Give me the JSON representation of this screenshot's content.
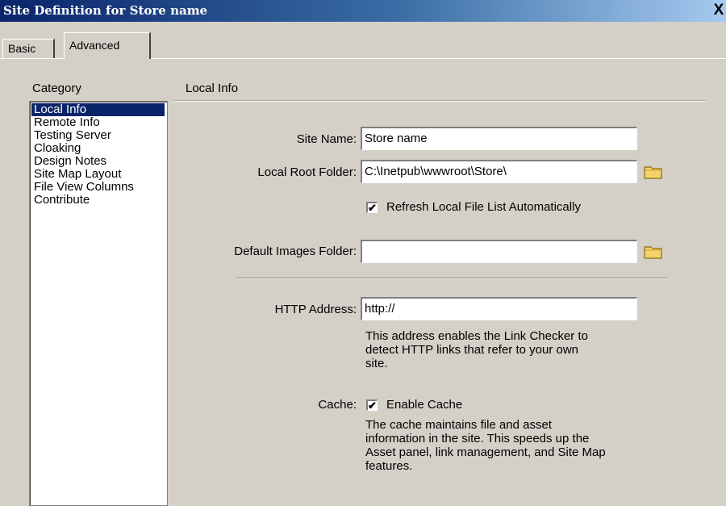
{
  "window": {
    "title": "Site Definition for Store name",
    "close_label": "X"
  },
  "tabs": [
    {
      "label": "Basic"
    },
    {
      "label": "Advanced",
      "selected": true
    }
  ],
  "category": {
    "heading": "Category",
    "items": [
      {
        "label": "Local Info",
        "selected": true
      },
      {
        "label": "Remote Info"
      },
      {
        "label": "Testing Server"
      },
      {
        "label": "Cloaking"
      },
      {
        "label": "Design Notes"
      },
      {
        "label": "Site Map Layout"
      },
      {
        "label": "File View Columns"
      },
      {
        "label": "Contribute"
      }
    ]
  },
  "local_info": {
    "heading": "Local Info",
    "site_name": {
      "label": "Site Name:",
      "value": "Store name"
    },
    "local_root_folder": {
      "label": "Local Root Folder:",
      "value": "C:\\Inetpub\\wwwroot\\Store\\"
    },
    "refresh_checkbox": {
      "label": "Refresh Local File List Automatically",
      "checked": true
    },
    "default_images_folder": {
      "label": "Default Images Folder:",
      "value": ""
    },
    "http_address": {
      "label": "HTTP Address:",
      "value": "http://",
      "help_lines": [
        "This address enables the Link Checker to",
        "detect HTTP links that refer to your own",
        "site."
      ]
    },
    "cache": {
      "label": "Cache:",
      "checkbox_label": "Enable Cache",
      "checked": true,
      "help_lines": [
        "The cache maintains file and asset",
        "information in the site.  This speeds up the",
        "Asset panel, link management, and Site Map",
        "features."
      ]
    }
  },
  "icons": {
    "folder": "folder-icon",
    "check": "✔"
  },
  "colors": {
    "selection": "#0a246a",
    "dialog": "#d4d0c8",
    "folder": "#f5d36b"
  }
}
